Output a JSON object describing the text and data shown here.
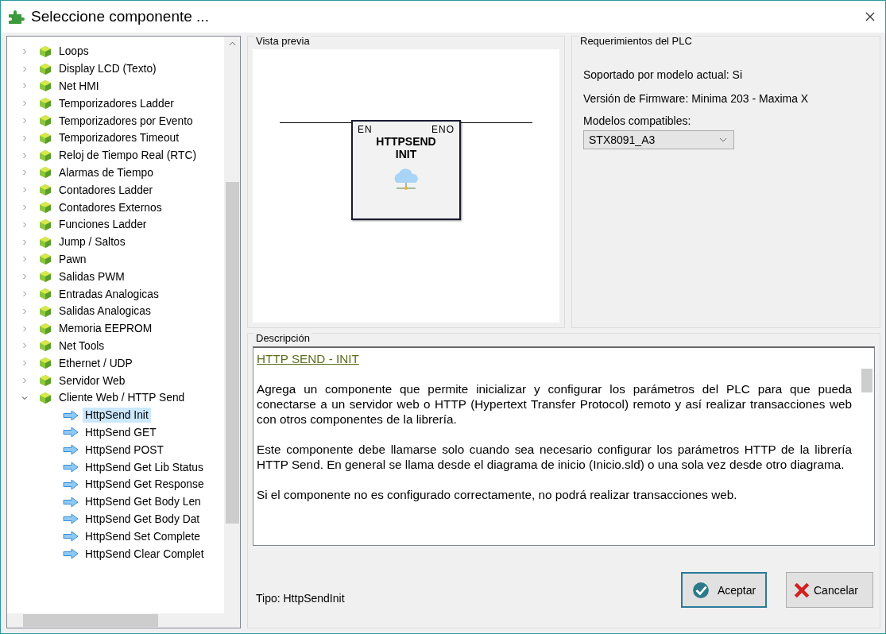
{
  "window": {
    "title": "Seleccione componente ..."
  },
  "tree": {
    "items": [
      {
        "label": "Loops",
        "expanded": false,
        "selected": false
      },
      {
        "label": "Display LCD (Texto)",
        "expanded": false,
        "selected": false
      },
      {
        "label": "Net HMI",
        "expanded": false,
        "selected": false
      },
      {
        "label": "Temporizadores Ladder",
        "expanded": false,
        "selected": false
      },
      {
        "label": "Temporizadores por Evento",
        "expanded": false,
        "selected": false
      },
      {
        "label": "Temporizadores Timeout",
        "expanded": false,
        "selected": false
      },
      {
        "label": "Reloj de Tiempo Real (RTC)",
        "expanded": false,
        "selected": false
      },
      {
        "label": "Alarmas de Tiempo",
        "expanded": false,
        "selected": false
      },
      {
        "label": "Contadores Ladder",
        "expanded": false,
        "selected": false
      },
      {
        "label": "Contadores Externos",
        "expanded": false,
        "selected": false
      },
      {
        "label": "Funciones Ladder",
        "expanded": false,
        "selected": false
      },
      {
        "label": "Jump / Saltos",
        "expanded": false,
        "selected": false
      },
      {
        "label": "Pawn",
        "expanded": false,
        "selected": false
      },
      {
        "label": "Salidas PWM",
        "expanded": false,
        "selected": false
      },
      {
        "label": "Entradas Analogicas",
        "expanded": false,
        "selected": false
      },
      {
        "label": "Salidas Analogicas",
        "expanded": false,
        "selected": false
      },
      {
        "label": "Memoria EEPROM",
        "expanded": false,
        "selected": false
      },
      {
        "label": "Net Tools",
        "expanded": false,
        "selected": false
      },
      {
        "label": "Ethernet / UDP",
        "expanded": false,
        "selected": false
      },
      {
        "label": "Servidor Web",
        "expanded": false,
        "selected": false
      },
      {
        "label": "Cliente Web / HTTP Send",
        "expanded": true,
        "selected": false,
        "children": [
          {
            "label": "HttpSend Init",
            "selected": true
          },
          {
            "label": "HttpSend GET",
            "selected": false
          },
          {
            "label": "HttpSend POST",
            "selected": false
          },
          {
            "label": "HttpSend Get Lib Status",
            "selected": false
          },
          {
            "label": "HttpSend Get Response",
            "selected": false
          },
          {
            "label": "HttpSend Get Body Len",
            "selected": false
          },
          {
            "label": "HttpSend Get Body Dat",
            "selected": false
          },
          {
            "label": "HttpSend Set Complete",
            "selected": false
          },
          {
            "label": "HttpSend Clear Complet",
            "selected": false
          }
        ]
      }
    ]
  },
  "preview": {
    "title": "Vista previa",
    "block": {
      "input": "EN",
      "output": "ENO",
      "name_lines": [
        "HTTPSEND",
        "INIT"
      ]
    }
  },
  "requirements": {
    "title": "Requerimientos del PLC",
    "lines": [
      "Soportado por modelo actual: Si",
      "Versión de Firmware: Minima 203 - Maxima X"
    ],
    "models_label": "Modelos compatibles:",
    "model": "STX8091_A3"
  },
  "description": {
    "title": "Descripción",
    "heading": "HTTP SEND - INIT",
    "paragraphs": [
      "Agrega un componente que permite inicializar y configurar los parámetros del PLC para que pueda conectarse a un servidor web o HTTP (Hypertext Transfer Protocol) remoto y así realizar transacciones web con otros componentes de la librería.",
      "Este componente debe llamarse solo cuando sea necesario configurar los parámetros HTTP de la librería HTTP Send. En general se llama desde el diagrama de inicio (Inicio.sld) o una sola vez desde otro diagrama.",
      "Si el componente no es configurado correctamente, no podrá realizar transacciones web."
    ]
  },
  "type_label": "Tipo: HttpSendInit",
  "buttons": [
    {
      "label": "Aceptar",
      "kind": "ok"
    },
    {
      "label": "Cancelar",
      "kind": "cancel"
    }
  ]
}
